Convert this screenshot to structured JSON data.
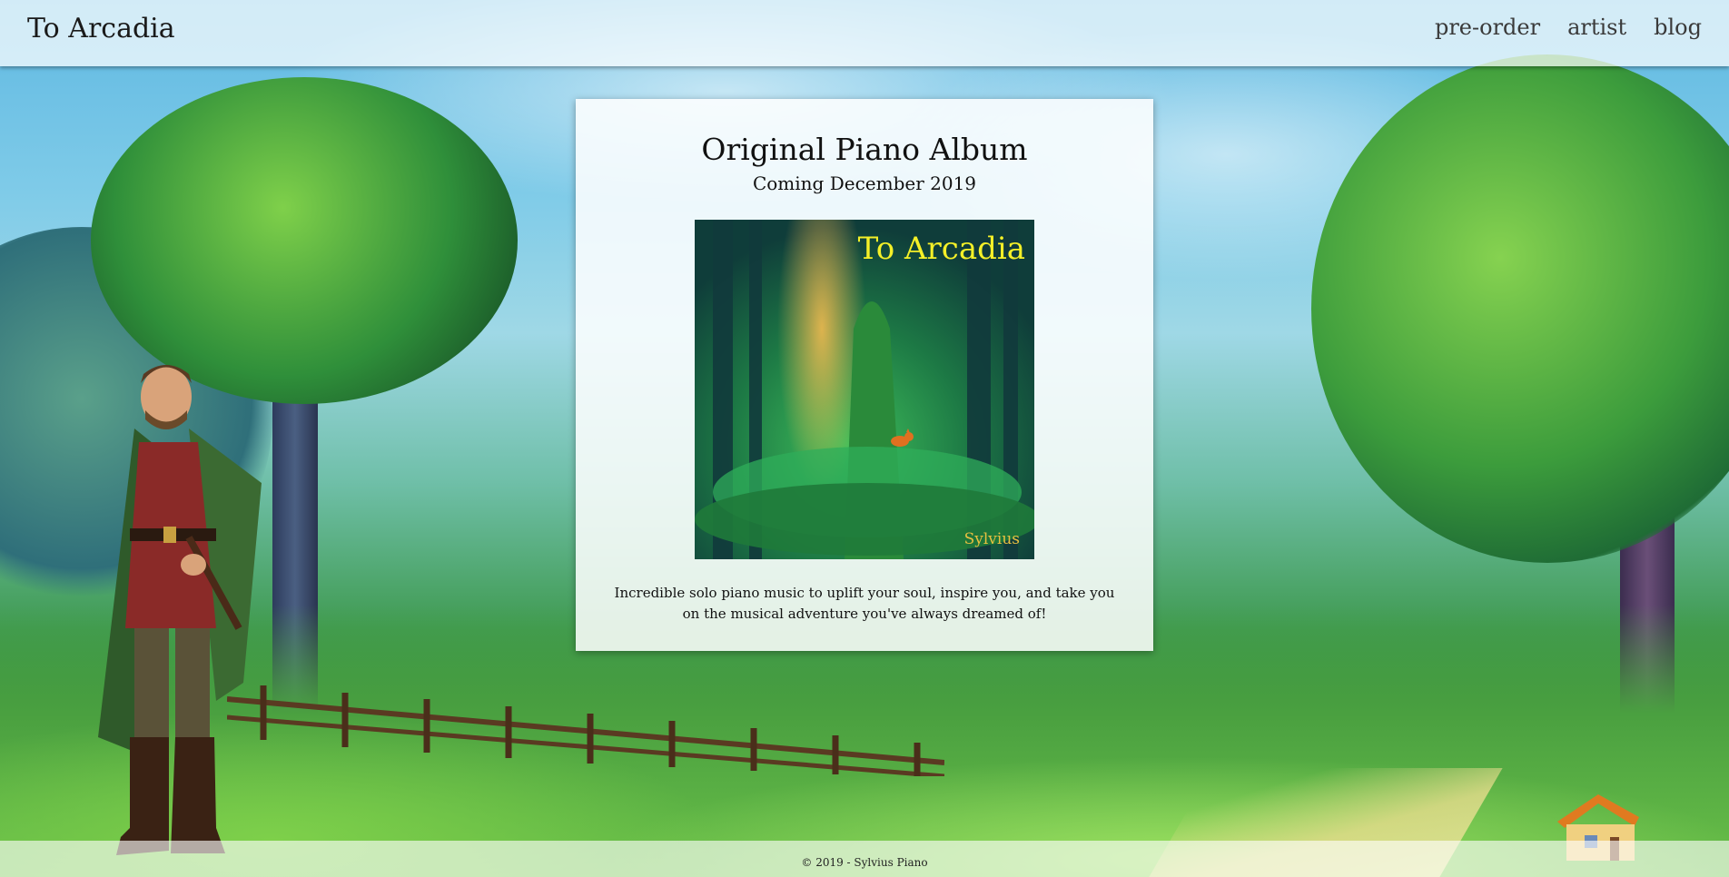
{
  "header": {
    "brand": "To Arcadia",
    "nav": [
      "pre-order",
      "artist",
      "blog"
    ]
  },
  "card": {
    "title": "Original Piano Album",
    "subtitle": "Coming December 2019",
    "cover_title": "To Arcadia",
    "cover_artist": "Sylvius",
    "description": "Incredible solo piano music to uplift your soul, inspire you, and take you on the musical adventure you've always dreamed of!"
  },
  "footer": {
    "copyright": "© 2019 - Sylvius Piano"
  },
  "colors": {
    "cover_title": "#f4f028",
    "cover_artist": "#e8c040",
    "topbar_bg": "rgba(255,255,255,0.72)"
  }
}
